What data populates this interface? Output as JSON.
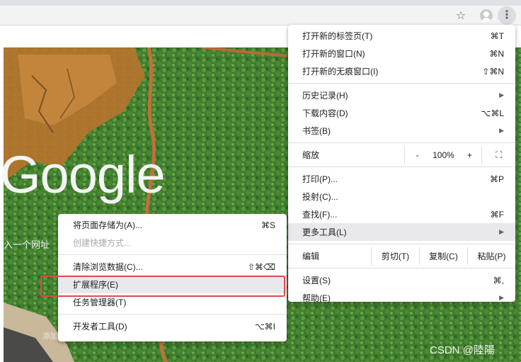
{
  "toolbar": {
    "star_icon": "star-icon",
    "avatar_icon": "profile-avatar-icon",
    "menu_icon": "more-vert-icon"
  },
  "ntp": {
    "logo": "Google",
    "search_hint": "入一个网址",
    "add_hint": "添加",
    "watermark": "CSDN @陸陽"
  },
  "main_menu": {
    "new_tab": {
      "label": "打开新的标签页(T)",
      "shortcut": "⌘T"
    },
    "new_window": {
      "label": "打开新的窗口(N)",
      "shortcut": "⌘N"
    },
    "new_incognito": {
      "label": "打开新的无痕窗口(I)",
      "shortcut": "⇧⌘N"
    },
    "history": {
      "label": "历史记录(H)"
    },
    "downloads": {
      "label": "下载内容(D)",
      "shortcut": "⌥⌘L"
    },
    "bookmarks": {
      "label": "书签(B)"
    },
    "zoom": {
      "label": "缩放",
      "minus": "-",
      "value": "100%",
      "plus": "+"
    },
    "print": {
      "label": "打印(P)...",
      "shortcut": "⌘P"
    },
    "cast": {
      "label": "投射(C)..."
    },
    "find": {
      "label": "查找(F)...",
      "shortcut": "⌘F"
    },
    "more_tools": {
      "label": "更多工具(L)"
    },
    "edit": {
      "label": "编辑",
      "cut": "剪切(T)",
      "copy": "复制(C)",
      "paste": "粘贴(P)"
    },
    "settings": {
      "label": "设置(S)",
      "shortcut": "⌘,"
    },
    "help": {
      "label": "帮助(E)"
    }
  },
  "sub_menu": {
    "save_page": {
      "label": "将页面存储为(A)...",
      "shortcut": "⌘S"
    },
    "create_shortcut": {
      "label": "创建快捷方式..."
    },
    "clear_data": {
      "label": "清除浏览数据(C)...",
      "shortcut": "⇧⌘⌫"
    },
    "extensions": {
      "label": "扩展程序(E)"
    },
    "task_manager": {
      "label": "任务管理器(T)"
    },
    "dev_tools": {
      "label": "开发者工具(D)",
      "shortcut": "⌥⌘I"
    }
  }
}
